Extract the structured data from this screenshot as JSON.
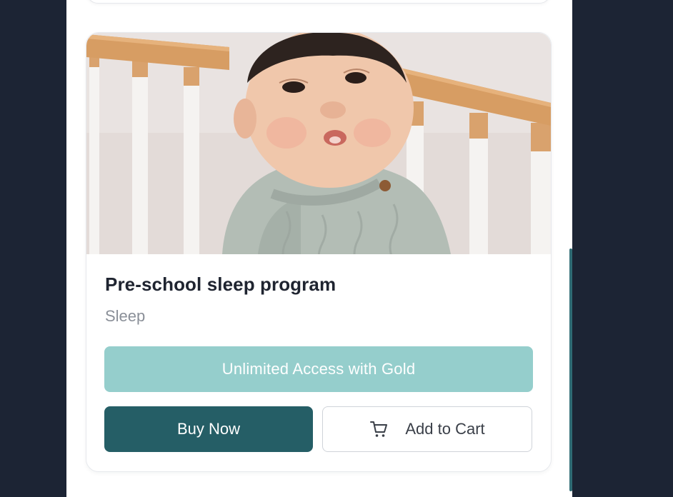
{
  "product": {
    "title": "Pre-school sleep program",
    "category": "Sleep",
    "image_subject": "baby-in-crib-photo"
  },
  "actions": {
    "gold_label": "Unlimited Access with Gold",
    "buy_label": "Buy Now",
    "cart_label": "Add to Cart",
    "cart_icon": "shopping-cart-icon"
  },
  "colors": {
    "gold_button": "#95cecc",
    "primary": "#255e66",
    "page_background": "#1c2434"
  }
}
